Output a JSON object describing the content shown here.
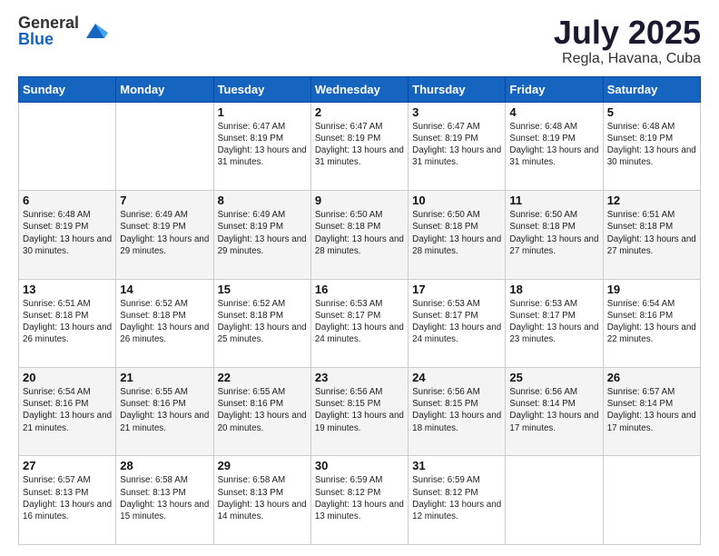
{
  "logo": {
    "general": "General",
    "blue": "Blue"
  },
  "header": {
    "month_year": "July 2025",
    "location": "Regla, Havana, Cuba"
  },
  "weekdays": [
    "Sunday",
    "Monday",
    "Tuesday",
    "Wednesday",
    "Thursday",
    "Friday",
    "Saturday"
  ],
  "weeks": [
    [
      {
        "day": "",
        "info": ""
      },
      {
        "day": "",
        "info": ""
      },
      {
        "day": "1",
        "info": "Sunrise: 6:47 AM\nSunset: 8:19 PM\nDaylight: 13 hours and 31 minutes."
      },
      {
        "day": "2",
        "info": "Sunrise: 6:47 AM\nSunset: 8:19 PM\nDaylight: 13 hours and 31 minutes."
      },
      {
        "day": "3",
        "info": "Sunrise: 6:47 AM\nSunset: 8:19 PM\nDaylight: 13 hours and 31 minutes."
      },
      {
        "day": "4",
        "info": "Sunrise: 6:48 AM\nSunset: 8:19 PM\nDaylight: 13 hours and 31 minutes."
      },
      {
        "day": "5",
        "info": "Sunrise: 6:48 AM\nSunset: 8:19 PM\nDaylight: 13 hours and 30 minutes."
      }
    ],
    [
      {
        "day": "6",
        "info": "Sunrise: 6:48 AM\nSunset: 8:19 PM\nDaylight: 13 hours and 30 minutes."
      },
      {
        "day": "7",
        "info": "Sunrise: 6:49 AM\nSunset: 8:19 PM\nDaylight: 13 hours and 29 minutes."
      },
      {
        "day": "8",
        "info": "Sunrise: 6:49 AM\nSunset: 8:19 PM\nDaylight: 13 hours and 29 minutes."
      },
      {
        "day": "9",
        "info": "Sunrise: 6:50 AM\nSunset: 8:18 PM\nDaylight: 13 hours and 28 minutes."
      },
      {
        "day": "10",
        "info": "Sunrise: 6:50 AM\nSunset: 8:18 PM\nDaylight: 13 hours and 28 minutes."
      },
      {
        "day": "11",
        "info": "Sunrise: 6:50 AM\nSunset: 8:18 PM\nDaylight: 13 hours and 27 minutes."
      },
      {
        "day": "12",
        "info": "Sunrise: 6:51 AM\nSunset: 8:18 PM\nDaylight: 13 hours and 27 minutes."
      }
    ],
    [
      {
        "day": "13",
        "info": "Sunrise: 6:51 AM\nSunset: 8:18 PM\nDaylight: 13 hours and 26 minutes."
      },
      {
        "day": "14",
        "info": "Sunrise: 6:52 AM\nSunset: 8:18 PM\nDaylight: 13 hours and 26 minutes."
      },
      {
        "day": "15",
        "info": "Sunrise: 6:52 AM\nSunset: 8:18 PM\nDaylight: 13 hours and 25 minutes."
      },
      {
        "day": "16",
        "info": "Sunrise: 6:53 AM\nSunset: 8:17 PM\nDaylight: 13 hours and 24 minutes."
      },
      {
        "day": "17",
        "info": "Sunrise: 6:53 AM\nSunset: 8:17 PM\nDaylight: 13 hours and 24 minutes."
      },
      {
        "day": "18",
        "info": "Sunrise: 6:53 AM\nSunset: 8:17 PM\nDaylight: 13 hours and 23 minutes."
      },
      {
        "day": "19",
        "info": "Sunrise: 6:54 AM\nSunset: 8:16 PM\nDaylight: 13 hours and 22 minutes."
      }
    ],
    [
      {
        "day": "20",
        "info": "Sunrise: 6:54 AM\nSunset: 8:16 PM\nDaylight: 13 hours and 21 minutes."
      },
      {
        "day": "21",
        "info": "Sunrise: 6:55 AM\nSunset: 8:16 PM\nDaylight: 13 hours and 21 minutes."
      },
      {
        "day": "22",
        "info": "Sunrise: 6:55 AM\nSunset: 8:16 PM\nDaylight: 13 hours and 20 minutes."
      },
      {
        "day": "23",
        "info": "Sunrise: 6:56 AM\nSunset: 8:15 PM\nDaylight: 13 hours and 19 minutes."
      },
      {
        "day": "24",
        "info": "Sunrise: 6:56 AM\nSunset: 8:15 PM\nDaylight: 13 hours and 18 minutes."
      },
      {
        "day": "25",
        "info": "Sunrise: 6:56 AM\nSunset: 8:14 PM\nDaylight: 13 hours and 17 minutes."
      },
      {
        "day": "26",
        "info": "Sunrise: 6:57 AM\nSunset: 8:14 PM\nDaylight: 13 hours and 17 minutes."
      }
    ],
    [
      {
        "day": "27",
        "info": "Sunrise: 6:57 AM\nSunset: 8:13 PM\nDaylight: 13 hours and 16 minutes."
      },
      {
        "day": "28",
        "info": "Sunrise: 6:58 AM\nSunset: 8:13 PM\nDaylight: 13 hours and 15 minutes."
      },
      {
        "day": "29",
        "info": "Sunrise: 6:58 AM\nSunset: 8:13 PM\nDaylight: 13 hours and 14 minutes."
      },
      {
        "day": "30",
        "info": "Sunrise: 6:59 AM\nSunset: 8:12 PM\nDaylight: 13 hours and 13 minutes."
      },
      {
        "day": "31",
        "info": "Sunrise: 6:59 AM\nSunset: 8:12 PM\nDaylight: 13 hours and 12 minutes."
      },
      {
        "day": "",
        "info": ""
      },
      {
        "day": "",
        "info": ""
      }
    ]
  ]
}
